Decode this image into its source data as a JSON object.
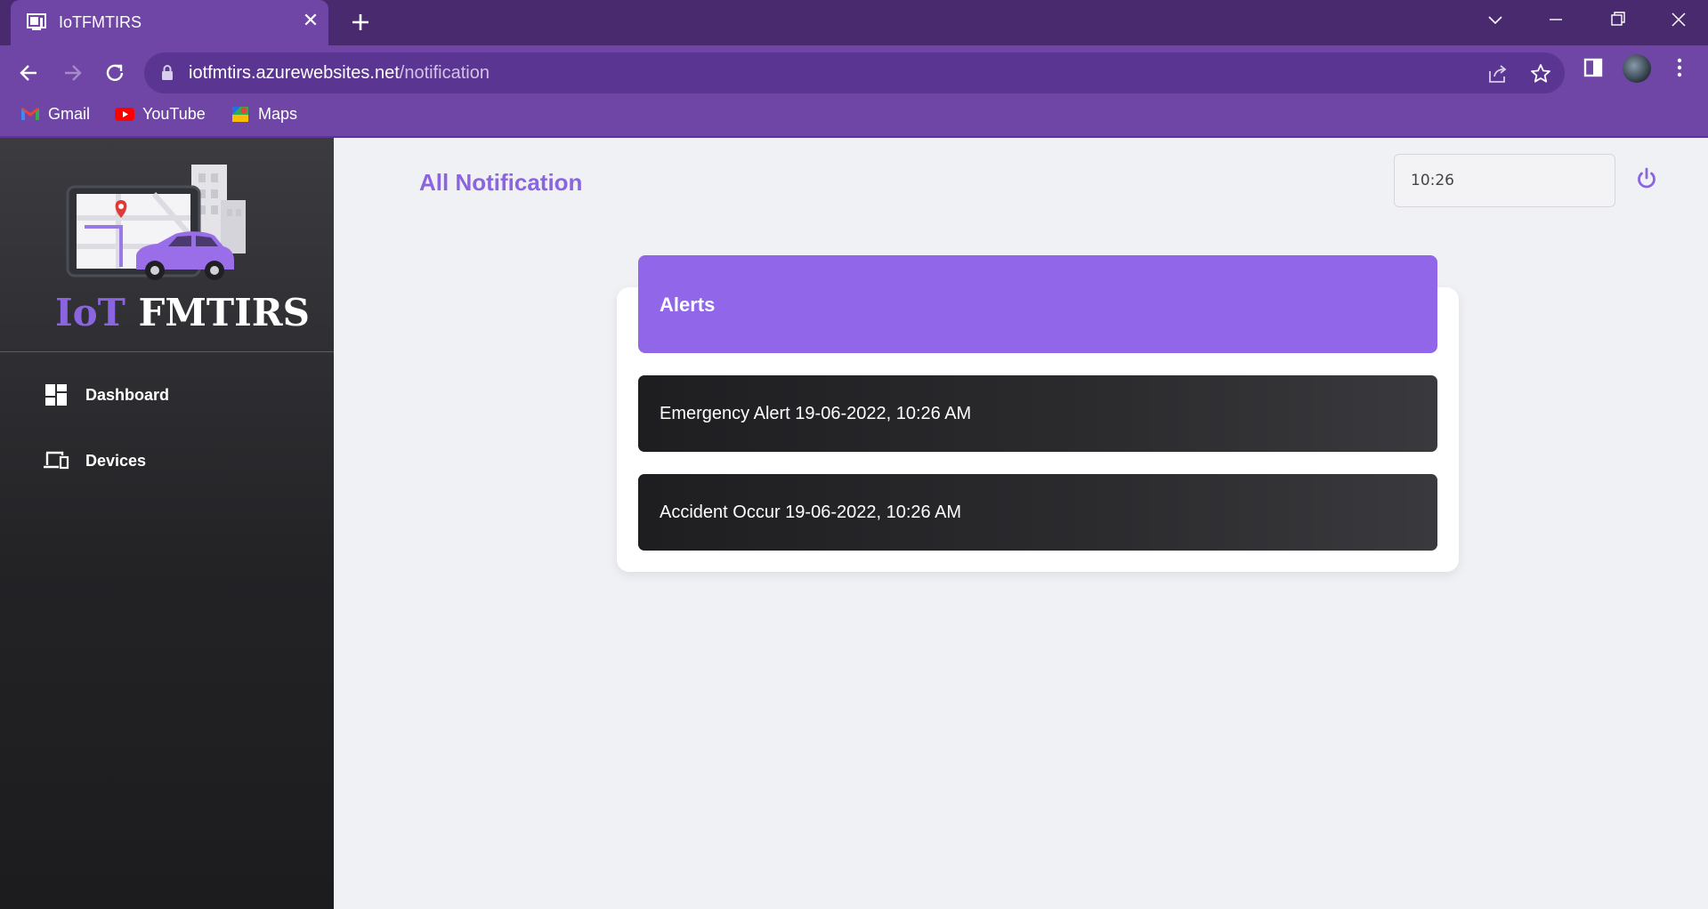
{
  "browser": {
    "tab_title": "IoTFMTIRS",
    "tab_close": "✕",
    "url_domain": "iotfmtirs.azurewebsites.net",
    "url_path": "/notification",
    "bookmarks": [
      {
        "label": "Gmail",
        "icon": "gmail-icon"
      },
      {
        "label": "YouTube",
        "icon": "youtube-icon"
      },
      {
        "label": "Maps",
        "icon": "maps-icon"
      }
    ]
  },
  "sidebar": {
    "logo_iot": "IoT",
    "logo_brand": "FMTIRS",
    "items": [
      {
        "label": "Dashboard",
        "icon": "dashboard-icon"
      },
      {
        "label": "Devices",
        "icon": "devices-icon"
      }
    ]
  },
  "header": {
    "title": "All Notification",
    "time_value": "10:26"
  },
  "alerts": {
    "title": "Alerts",
    "items": [
      {
        "text": "Emergency Alert 19-06-2022, 10:26 AM"
      },
      {
        "text": "Accident Occur 19-06-2022, 10:26 AM"
      }
    ]
  },
  "colors": {
    "accent": "#9166e8",
    "title_purple": "#8b64e0",
    "browser_frame": "#6f45a6",
    "sidebar_dark": "#2a2a2d"
  }
}
